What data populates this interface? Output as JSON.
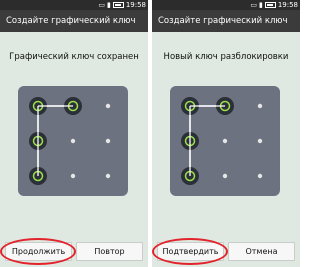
{
  "screens": [
    {
      "status_time": "19:58",
      "title": "Создайте графический ключ",
      "message": "Графический ключ сохранен",
      "primary_button": "Продолжить",
      "secondary_button": "Повтор",
      "highlighted_button": "primary"
    },
    {
      "status_time": "19:58",
      "title": "Создайте графический ключ",
      "message": "Новый ключ разблокировки",
      "primary_button": "Подтвердить",
      "secondary_button": "Отмена",
      "highlighted_button": "primary"
    }
  ],
  "pattern": {
    "rows": 3,
    "cols": 3,
    "sequence": [
      2,
      1,
      4,
      7
    ],
    "colors": {
      "grid_bg": "#6d7280",
      "active_ring": "#2b2f37",
      "active_dot": "#9be04a",
      "line": "#ffffff",
      "inactive_dot": "#e6e6e6"
    }
  },
  "colors": {
    "status_bar": "#2c2c2c",
    "title_bar": "#3b3b3b",
    "background": "#dfe9e1",
    "highlight": "#e2232b"
  }
}
